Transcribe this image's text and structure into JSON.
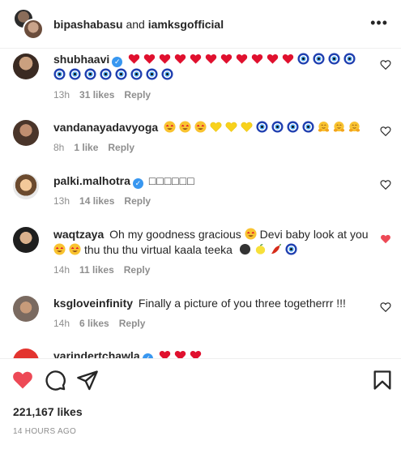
{
  "header": {
    "user1": "bipashabasu",
    "conjunction": " and ",
    "user2": "iamksgofficial",
    "more_icon": "more-horizontal-icon"
  },
  "comments": [
    {
      "username": "shubhaavi",
      "verified": true,
      "text": "",
      "emoji": [
        "heart",
        "heart",
        "heart",
        "heart",
        "heart",
        "heart",
        "heart",
        "heart",
        "heart",
        "heart",
        "heart",
        "evil-eye",
        "evil-eye",
        "evil-eye",
        "evil-eye",
        "evil-eye",
        "evil-eye",
        "evil-eye",
        "evil-eye",
        "evil-eye",
        "evil-eye",
        "evil-eye",
        "evil-eye"
      ],
      "time": "13h",
      "likes": "31 likes",
      "reply": "Reply",
      "liked": false
    },
    {
      "username": "vandanayadavyoga",
      "verified": false,
      "text": "",
      "emoji": [
        "heart-eyes-face",
        "heart-eyes-face",
        "heart-eyes-face",
        "yellow-heart",
        "yellow-heart",
        "yellow-heart",
        "evil-eye",
        "evil-eye",
        "evil-eye",
        "evil-eye",
        "hug-face",
        "hug-face",
        "hug-face"
      ],
      "time": "8h",
      "likes": "1 like",
      "reply": "Reply",
      "liked": false
    },
    {
      "username": "palki.malhotra",
      "verified": true,
      "text": "□□□□□□",
      "emoji": [],
      "time": "13h",
      "likes": "14 likes",
      "reply": "Reply",
      "liked": false
    },
    {
      "username": "waqtzaya",
      "verified": false,
      "text_before": "Oh my goodness gracious",
      "text_after": "Devi baby look at you",
      "text_line2": "thu thu thu virtual kaala teeka",
      "time": "14h",
      "likes": "11 likes",
      "reply": "Reply",
      "liked": true
    },
    {
      "username": "ksgloveinfinity",
      "verified": false,
      "text": "Finally a picture of you three togetherrr !!!",
      "emoji": [],
      "time": "14h",
      "likes": "6 likes",
      "reply": "Reply",
      "liked": false
    },
    {
      "username": "varindertchawla",
      "verified": true,
      "text": "",
      "emoji": [
        "heart",
        "heart",
        "heart"
      ],
      "time": "",
      "likes": "",
      "reply": "",
      "liked": false
    }
  ],
  "actions": {
    "like_icon": "heart-filled-icon",
    "comment_icon": "comment-icon",
    "share_icon": "share-icon",
    "save_icon": "bookmark-icon"
  },
  "post": {
    "likes": "221,167 likes",
    "time_ago": "14 HOURS AGO"
  },
  "colors": {
    "like_red": "#ed4956",
    "verified_blue": "#3897f0",
    "meta_gray": "#8e8e8e",
    "text": "#262626"
  }
}
